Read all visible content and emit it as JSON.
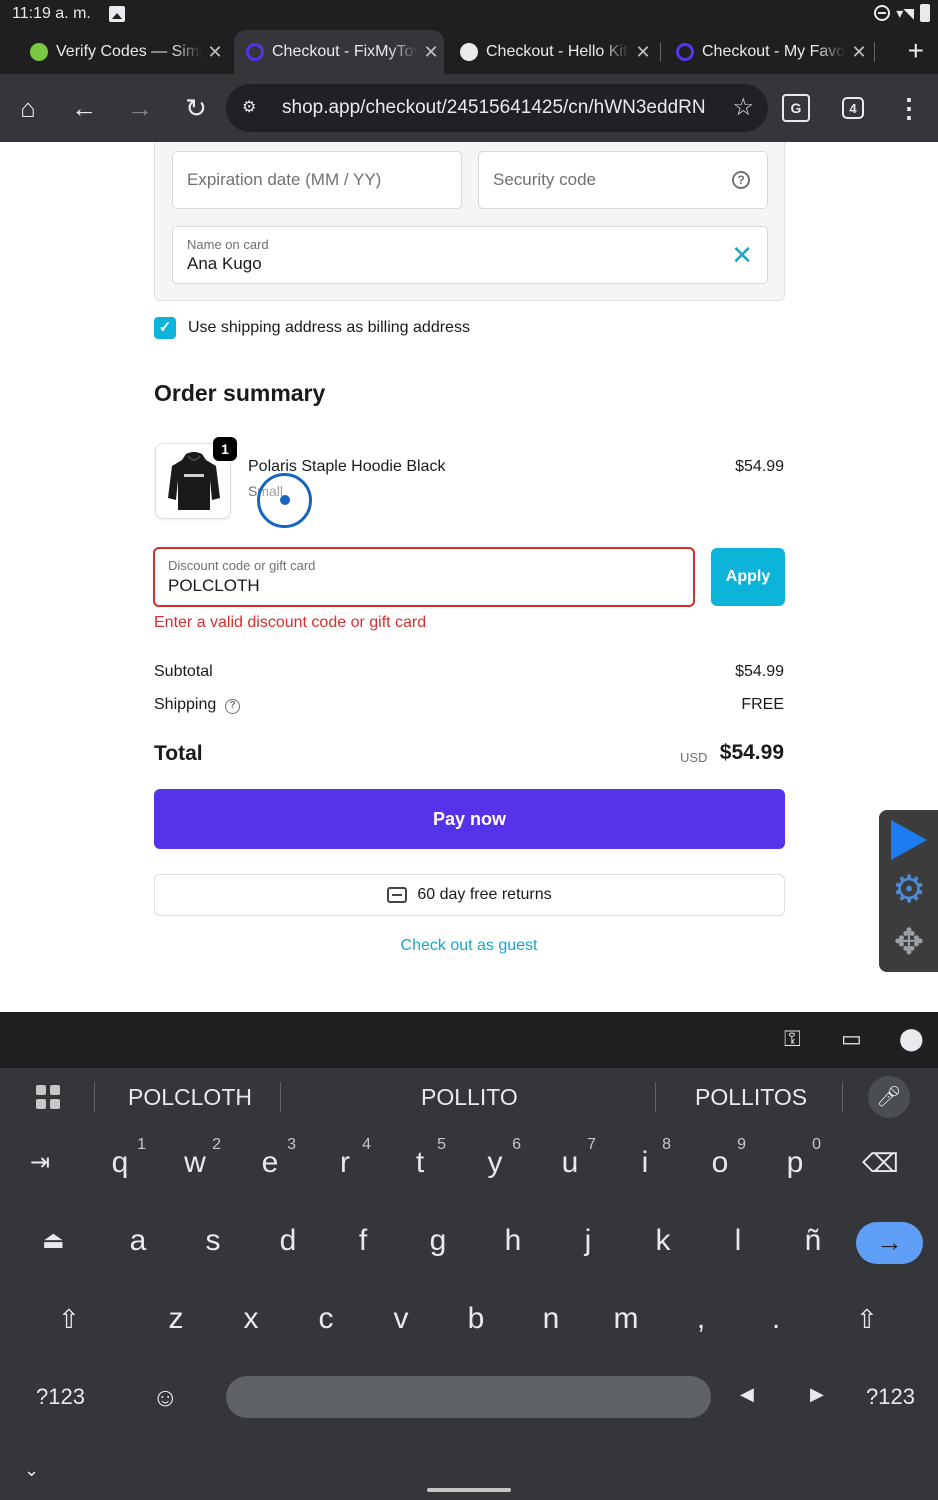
{
  "status_bar": {
    "time": "11:19 a. m."
  },
  "tabs": [
    {
      "label": "Verify Codes — SimplyCodes",
      "favicon_color": "#7ac943"
    },
    {
      "label": "Checkout - FixMyToys",
      "favicon_color": "#5433eb"
    },
    {
      "label": "Checkout - Hello Kitty",
      "favicon_color": "#e8eaed"
    },
    {
      "label": "Checkout - My Favorite",
      "favicon_color": "#5433eb"
    }
  ],
  "toolbar": {
    "url": "shop.app/checkout/24515641425/cn/hWN3eddRN",
    "tab_count": "4"
  },
  "payment": {
    "expiration_placeholder": "Expiration date (MM / YY)",
    "security_placeholder": "Security code",
    "name_label": "Name on card",
    "name_value": "Ana Kugo",
    "billing_checkbox_label": "Use shipping address as billing address"
  },
  "order_summary": {
    "title": "Order summary",
    "item": {
      "name": "Polaris Staple Hoodie Black",
      "variant": "Small",
      "price": "$54.99",
      "quantity": "1"
    },
    "discount": {
      "label": "Discount code or gift card",
      "value": "POLCLOTH",
      "apply_label": "Apply",
      "error": "Enter a valid discount code or gift card"
    },
    "subtotal_label": "Subtotal",
    "subtotal_value": "$54.99",
    "shipping_label": "Shipping",
    "shipping_value": "FREE",
    "total_label": "Total",
    "total_currency": "USD",
    "total_value": "$54.99"
  },
  "actions": {
    "pay_label": "Pay now",
    "returns_label": "60 day free returns",
    "guest_label": "Check out as guest"
  },
  "keyboard": {
    "suggestions": [
      "POLCLOTH",
      "POLLITO",
      "POLLITOS"
    ],
    "row1": [
      {
        "k": "q",
        "h": "1"
      },
      {
        "k": "w",
        "h": "2"
      },
      {
        "k": "e",
        "h": "3"
      },
      {
        "k": "r",
        "h": "4"
      },
      {
        "k": "t",
        "h": "5"
      },
      {
        "k": "y",
        "h": "6"
      },
      {
        "k": "u",
        "h": "7"
      },
      {
        "k": "i",
        "h": "8"
      },
      {
        "k": "o",
        "h": "9"
      },
      {
        "k": "p",
        "h": "0"
      }
    ],
    "row2": [
      "a",
      "s",
      "d",
      "f",
      "g",
      "h",
      "j",
      "k",
      "l",
      "ñ"
    ],
    "row3": [
      "z",
      "x",
      "c",
      "v",
      "b",
      "n",
      "m",
      ",",
      "."
    ],
    "symbols_label": "?123"
  },
  "colors": {
    "accent": "#0db4d9",
    "pay_button": "#5433eb",
    "error": "#d32f2f"
  }
}
